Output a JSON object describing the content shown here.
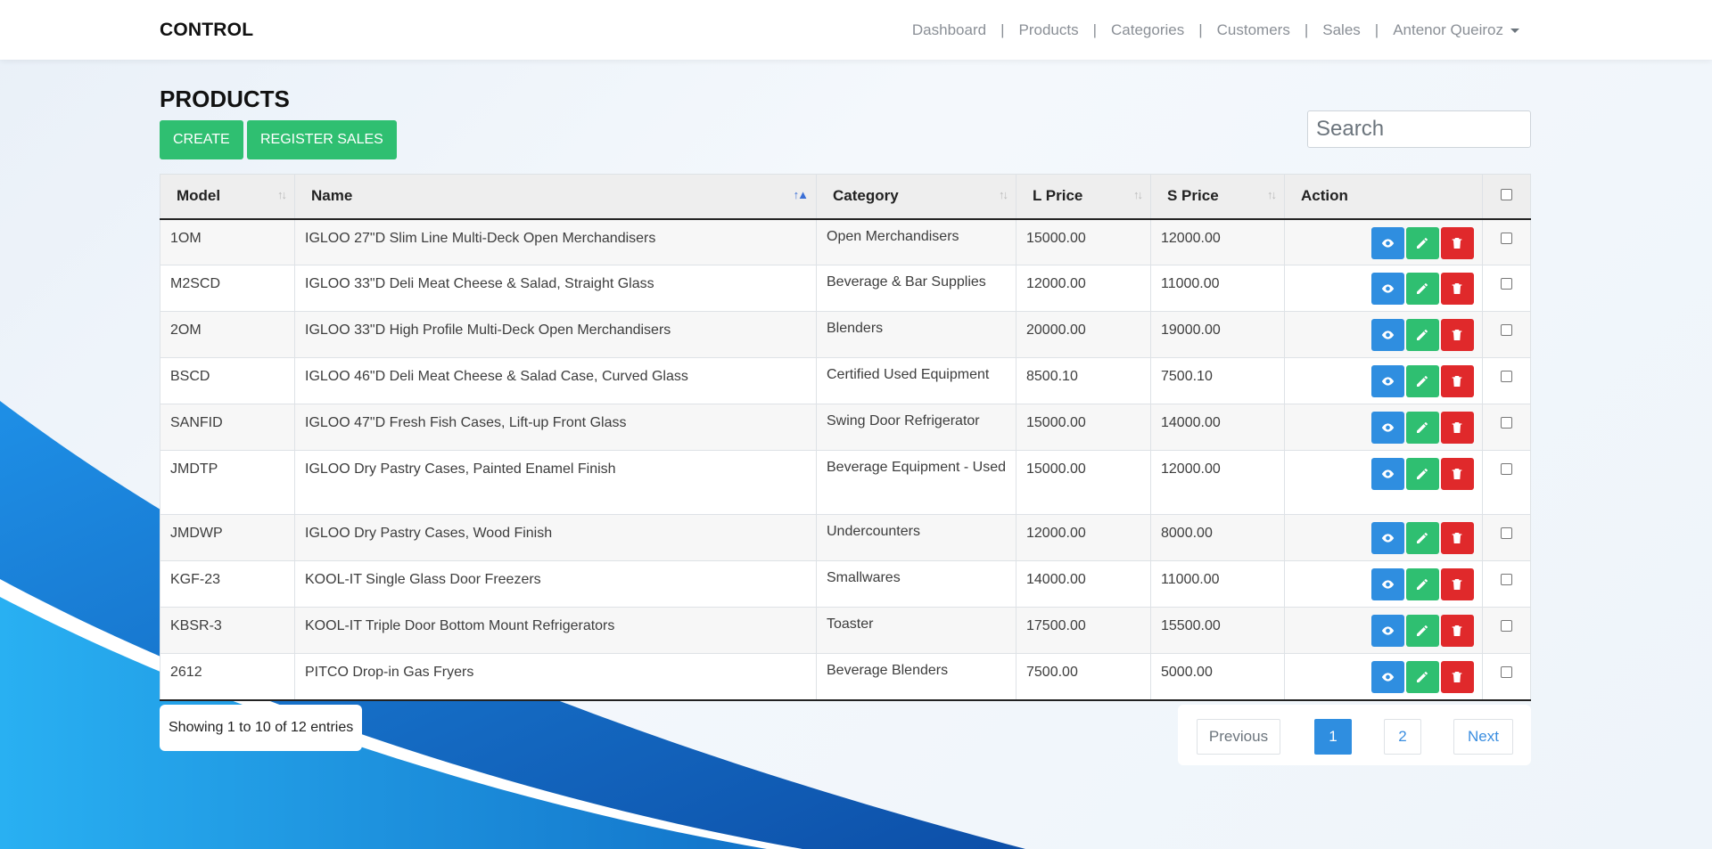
{
  "navbar": {
    "brand": "CONTROL",
    "links": [
      "Dashboard",
      "Products",
      "Categories",
      "Customers",
      "Sales"
    ],
    "user": "Antenor Queiroz"
  },
  "page": {
    "title": "PRODUCTS",
    "create_label": "CREATE",
    "register_sales_label": "REGISTER SALES",
    "search_placeholder": "Search"
  },
  "table": {
    "headers": {
      "model": "Model",
      "name": "Name",
      "category": "Category",
      "lprice": "L Price",
      "sprice": "S Price",
      "action": "Action"
    },
    "rows": [
      {
        "model": "1OM",
        "name": "IGLOO 27\"D Slim Line Multi-Deck Open Merchandisers",
        "category": "Open Merchandisers",
        "lprice": "15000.00",
        "sprice": "12000.00"
      },
      {
        "model": "M2SCD",
        "name": "IGLOO 33\"D Deli Meat Cheese & Salad, Straight Glass",
        "category": "Beverage & Bar Supplies",
        "lprice": "12000.00",
        "sprice": "11000.00"
      },
      {
        "model": "2OM",
        "name": "IGLOO 33\"D High Profile Multi-Deck Open Merchandisers",
        "category": "Blenders",
        "lprice": "20000.00",
        "sprice": "19000.00"
      },
      {
        "model": "BSCD",
        "name": "IGLOO 46\"D Deli Meat Cheese & Salad Case, Curved Glass",
        "category": "Certified Used Equipment",
        "lprice": "8500.10",
        "sprice": "7500.10"
      },
      {
        "model": "SANFID",
        "name": "IGLOO 47\"D Fresh Fish Cases, Lift-up Front Glass",
        "category": "Swing Door Refrigerator",
        "lprice": "15000.00",
        "sprice": "14000.00"
      },
      {
        "model": "JMDTP",
        "name": "IGLOO Dry Pastry Cases, Painted Enamel Finish",
        "category": "Beverage Equipment - Used",
        "lprice": "15000.00",
        "sprice": "12000.00"
      },
      {
        "model": "JMDWP",
        "name": "IGLOO Dry Pastry Cases, Wood Finish",
        "category": "Undercounters",
        "lprice": "12000.00",
        "sprice": "8000.00"
      },
      {
        "model": "KGF-23",
        "name": "KOOL-IT Single Glass Door Freezers",
        "category": "Smallwares",
        "lprice": "14000.00",
        "sprice": "11000.00"
      },
      {
        "model": "KBSR-3",
        "name": "KOOL-IT Triple Door Bottom Mount Refrigerators",
        "category": "Toaster",
        "lprice": "17500.00",
        "sprice": "15500.00"
      },
      {
        "model": "2612",
        "name": "PITCO Drop-in Gas Fryers",
        "category": "Beverage Blenders",
        "lprice": "7500.00",
        "sprice": "5000.00"
      }
    ],
    "action_icons": [
      "eye-icon",
      "pencil-icon",
      "trash-icon"
    ]
  },
  "footer": {
    "info": "Showing 1 to 10 of 12 entries",
    "prev_label": "Previous",
    "pages": [
      "1",
      "2"
    ],
    "next_label": "Next"
  },
  "colors": {
    "green": "#2fbf71",
    "blue": "#2f8ee0",
    "red": "#e0292b"
  }
}
